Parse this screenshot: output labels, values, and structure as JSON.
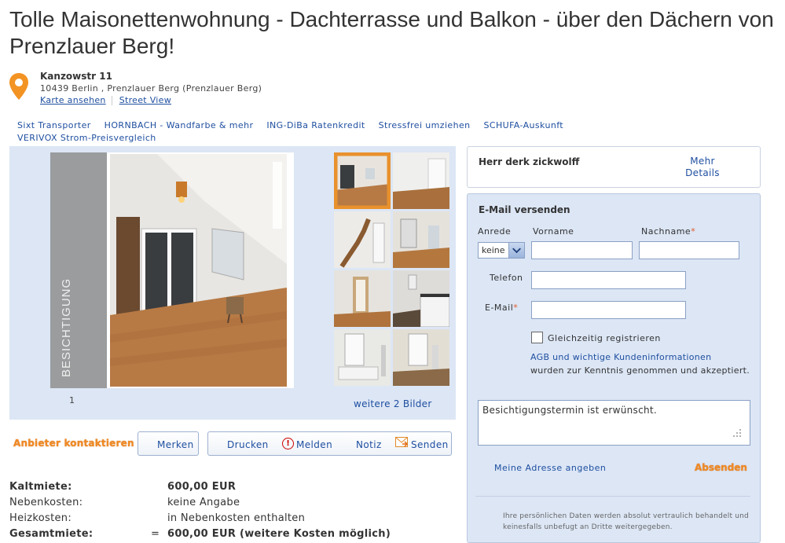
{
  "title": "Tolle Maisonettenwohnung - Dachterrasse und Balkon - über den Dächern von Prenzlauer Berg!",
  "address": {
    "street": "Kanzowstr 11",
    "city": "10439 Berlin , Prenzlauer Berg (Prenzlauer Berg)",
    "map_link": "Karte ansehen",
    "streetview_link": "Street View"
  },
  "ads": [
    "Sixt Transporter",
    "HORNBACH - Wandfarbe & mehr",
    "ING-DiBa Ratenkredit",
    "Stressfrei umziehen",
    "SCHUFA-Auskunft",
    "VERIVOX Strom-Preisvergleich"
  ],
  "gallery": {
    "overlay_text": "BESICHTIGUNG",
    "index": "1",
    "more_link": "weitere 2 Bilder"
  },
  "actions": {
    "contact": "Anbieter kontaktieren",
    "bookmark": "Merken",
    "print": "Drucken",
    "report": "Melden",
    "note": "Notiz",
    "send": "Senden"
  },
  "costs": [
    {
      "label": "Kaltmiete:",
      "eq": "",
      "value": "600,00 EUR",
      "bold": true
    },
    {
      "label": "Nebenkosten:",
      "eq": "",
      "value": "keine Angabe",
      "bold": false
    },
    {
      "label": "Heizkosten:",
      "eq": "",
      "value": "in Nebenkosten enthalten",
      "bold": false
    },
    {
      "label": "Gesamtmiete:",
      "eq": "=",
      "value": "600,00 EUR (weitere Kosten möglich)",
      "bold": true
    }
  ],
  "owner": {
    "name": "Herr derk zickwolff",
    "more_details": "Mehr Details"
  },
  "email_form": {
    "title": "E-Mail versenden",
    "salutation_label": "Anrede",
    "salutation_value": "keine",
    "firstname_label": "Vorname",
    "lastname_label": "Nachname",
    "phone_label": "Telefon",
    "email_label": "E-Mail",
    "required_mark": "*",
    "register_label": "Gleichzeitig registrieren",
    "terms_link": "AGB und wichtige Kundeninformationen",
    "terms_text": "wurden zur Kenntnis genommen und akzeptiert.",
    "message": "Besichtigungstermin ist erwünscht.",
    "address_link": "Meine Adresse angeben",
    "submit": "Absenden",
    "privacy": "Ihre persönlichen Daten werden absolut vertraulich behandelt und keinesfalls unbefugt an Dritte weitergegeben."
  },
  "colors": {
    "accent_orange": "#f08a24",
    "link_blue": "#1f4fa0",
    "panel_blue": "#dce6f5"
  }
}
